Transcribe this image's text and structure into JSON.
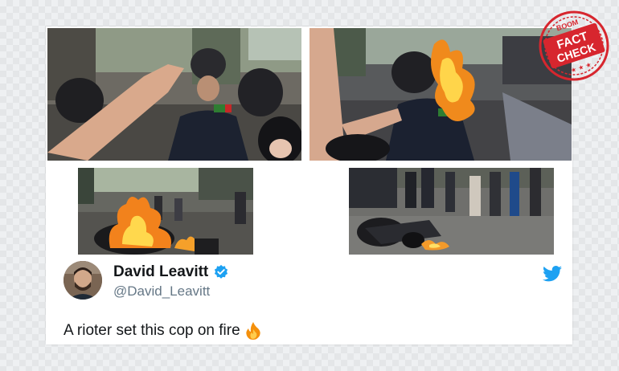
{
  "tweet": {
    "display_name": "David Leavitt",
    "handle": "@David_Leavitt",
    "text": "A rioter set this cop on fire",
    "verified": true
  },
  "icons": {
    "verified": "verified-badge-icon",
    "platform": "twitter-bird-icon",
    "emoji": "fire-emoji"
  },
  "stamp": {
    "brand": "BOOM",
    "line1": "FACT",
    "line2": "CHECK",
    "color": "#d7262e"
  },
  "colors": {
    "twitter_blue": "#1da1f2",
    "text": "#14171a",
    "muted": "#657786"
  }
}
